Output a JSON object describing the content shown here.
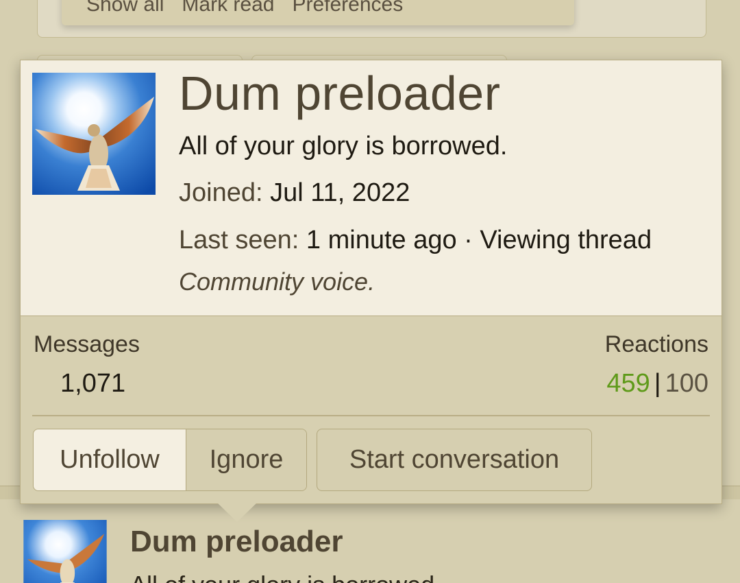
{
  "background": {
    "menu_links": [
      "Show all",
      "Mark read",
      "Preferences"
    ],
    "post_username": "Dum preloader",
    "post_snippet": "All of your glory is borrowed."
  },
  "profile": {
    "username": "Dum preloader",
    "tagline": "All of your glory is borrowed.",
    "joined_label": "Joined:",
    "joined_value": "Jul 11, 2022",
    "last_seen_label": "Last seen:",
    "last_seen_value": "1 minute ago · Viewing thread",
    "user_title": "Community voice.",
    "avatar_icon": "dove-avatar"
  },
  "stats": {
    "messages_label": "Messages",
    "messages_value": "1,071",
    "reactions_label": "Reactions",
    "reactions_positive": "459",
    "reactions_separator": "|",
    "reactions_negative": "100"
  },
  "actions": {
    "unfollow": "Unfollow",
    "ignore": "Ignore",
    "start_conversation": "Start conversation"
  },
  "colors": {
    "accent_positive": "#5f9a1a",
    "username": "#4f4533",
    "card_top": "#f3eee0",
    "card_body": "#d7d0b1"
  }
}
